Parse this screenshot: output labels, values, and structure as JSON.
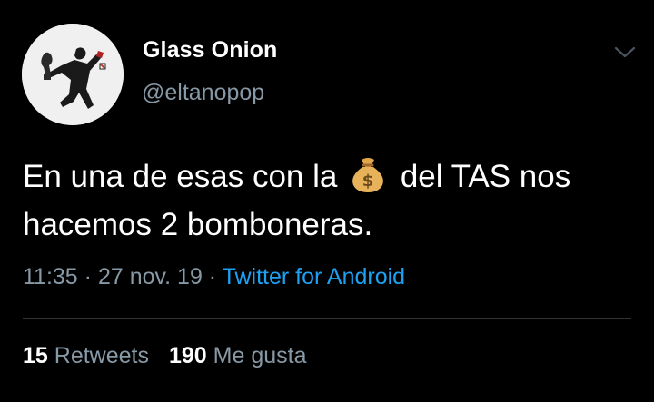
{
  "user": {
    "display_name": "Glass Onion",
    "handle": "@eltanopop",
    "avatar_icon": "avatar-photo"
  },
  "menu": {
    "icon": "chevron-down-icon"
  },
  "tweet": {
    "text_before_emoji": "En una de esas con la ",
    "emoji_icon": "money-bag-emoji",
    "text_after_emoji": " del TAS nos hacemos 2 bomboneras."
  },
  "meta": {
    "time": "11:35",
    "separator1": " · ",
    "date": "27 nov. 19",
    "separator2": " · ",
    "source": "Twitter for Android"
  },
  "stats": {
    "retweets_count": "15",
    "retweets_label": "Retweets",
    "likes_count": "190",
    "likes_label": "Me gusta"
  },
  "colors": {
    "background": "#000000",
    "primary_text": "#ffffff",
    "secondary_text": "#8899a6",
    "link": "#1da1f2",
    "divider": "#2f3336"
  }
}
